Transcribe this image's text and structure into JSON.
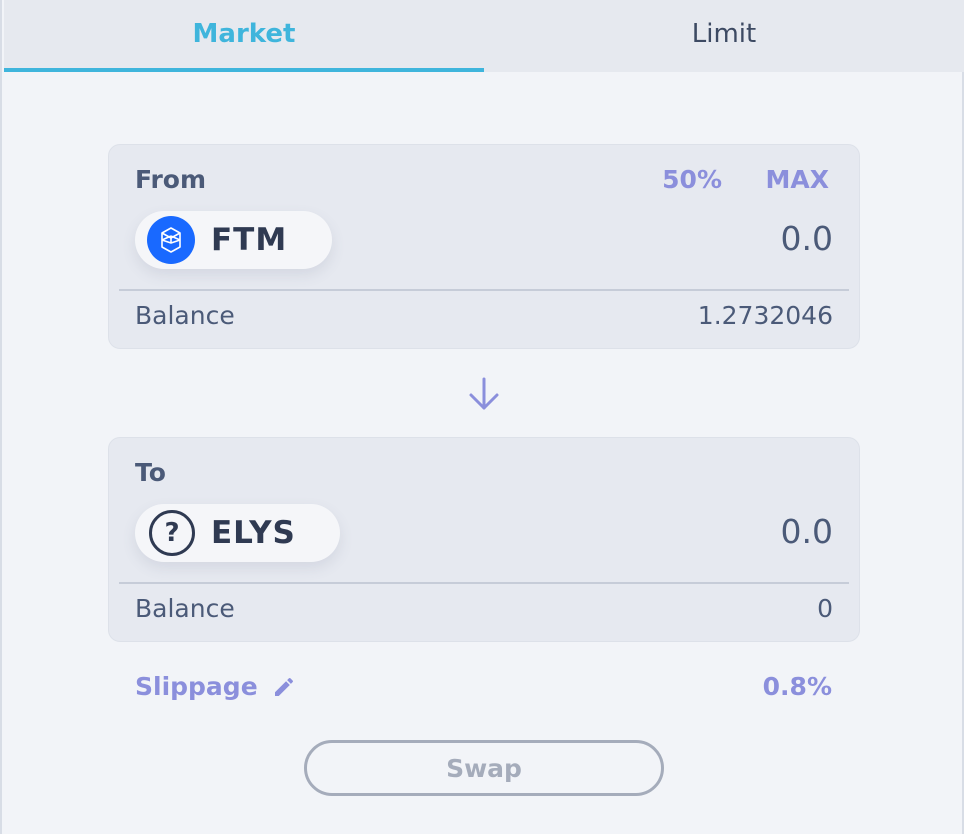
{
  "tabs": [
    {
      "label": "Market",
      "active": true
    },
    {
      "label": "Limit",
      "active": false
    }
  ],
  "from": {
    "label": "From",
    "quick_half": "50%",
    "quick_max": "MAX",
    "token": {
      "symbol": "FTM",
      "icon": "fantom-icon"
    },
    "amount": "0.0",
    "balance_label": "Balance",
    "balance_value": "1.2732046"
  },
  "switch_icon": "arrow-down-icon",
  "to": {
    "label": "To",
    "token": {
      "symbol": "ELYS",
      "icon": "question-mark-icon",
      "icon_glyph": "?"
    },
    "amount": "0.0",
    "balance_label": "Balance",
    "balance_value": "0"
  },
  "slippage": {
    "label": "Slippage",
    "icon": "pencil-icon",
    "value": "0.8%"
  },
  "swap_button": {
    "label": "Swap",
    "disabled": true
  },
  "colors": {
    "accent": "#3fb5dc",
    "secondary_accent": "#8b8fdc",
    "fantom_blue": "#1969ff",
    "text": "#3d4a63",
    "disabled": "#a5acbb"
  }
}
